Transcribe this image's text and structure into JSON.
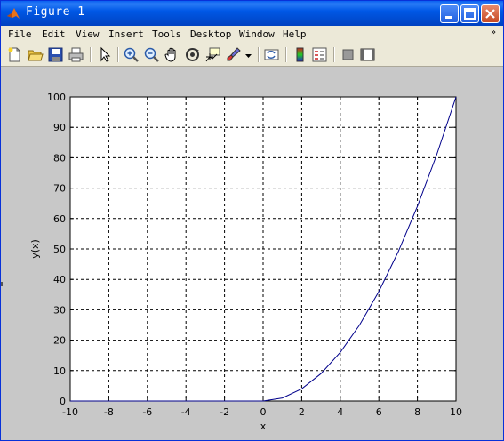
{
  "window": {
    "title": "Figure 1"
  },
  "menu": [
    "File",
    "Edit",
    "View",
    "Insert",
    "Tools",
    "Desktop",
    "Window",
    "Help"
  ],
  "menu_overflow": "»",
  "toolbar_icons": [
    "new-figure-icon",
    "open-file-icon",
    "save-icon",
    "print-icon",
    "edit-plot-arrow-icon",
    "zoom-in-icon",
    "zoom-out-icon",
    "pan-hand-icon",
    "rotate-3d-icon",
    "data-cursor-icon",
    "brush-icon",
    "brush-dropdown-icon",
    "link-plot-icon",
    "colorbar-icon",
    "legend-icon",
    "hide-plot-tools-icon",
    "show-plot-tools-icon"
  ],
  "chart_data": {
    "type": "line",
    "xlabel": "x",
    "ylabel": "y(x)",
    "xlim": [
      -10,
      10
    ],
    "ylim": [
      0,
      100
    ],
    "xticks": [
      -10,
      -8,
      -6,
      -4,
      -2,
      0,
      2,
      4,
      6,
      8,
      10
    ],
    "yticks": [
      0,
      10,
      20,
      30,
      40,
      50,
      60,
      70,
      80,
      90,
      100
    ],
    "grid": true,
    "line_color": "#00008b",
    "series": [
      {
        "x": [
          -10,
          -8,
          -6,
          -4,
          -2,
          0,
          1,
          2,
          3,
          4,
          5,
          6,
          7,
          8,
          9,
          10
        ],
        "y": [
          0,
          0,
          0,
          0,
          0,
          0,
          1,
          4,
          9,
          16,
          25,
          36,
          49,
          64,
          81,
          100
        ]
      }
    ]
  }
}
